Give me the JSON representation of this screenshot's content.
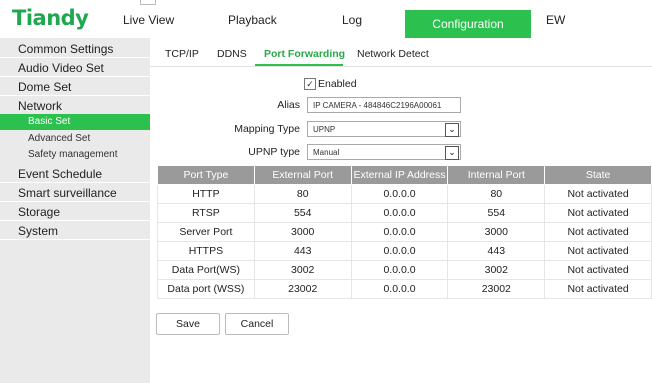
{
  "header": {
    "logo": "Tiandy",
    "nav": [
      {
        "label": "Live View"
      },
      {
        "label": "Playback"
      },
      {
        "label": "Log"
      },
      {
        "label": "Configuration",
        "active": true
      },
      {
        "label": "EW"
      }
    ]
  },
  "sidebar": {
    "items": [
      {
        "label": "Common Settings"
      },
      {
        "label": "Audio Video Set"
      },
      {
        "label": "Dome Set"
      },
      {
        "label": "Network"
      },
      {
        "label": "Basic Set",
        "active": true
      },
      {
        "label": "Advanced Set"
      },
      {
        "label": "Safety management"
      },
      {
        "label": "Event Schedule"
      },
      {
        "label": "Smart surveillance"
      },
      {
        "label": "Storage"
      },
      {
        "label": "System"
      }
    ]
  },
  "tabs": [
    {
      "label": "TCP/IP"
    },
    {
      "label": "DDNS"
    },
    {
      "label": "Port Forwarding",
      "active": true
    },
    {
      "label": "Network Detect"
    }
  ],
  "form": {
    "enabled_label": "Enabled",
    "enabled": true,
    "alias_label": "Alias",
    "alias_value": "IP CAMERA - 484846C2196A00061",
    "mapping_label": "Mapping Type",
    "mapping_value": "UPNP",
    "upnp_label": "UPNP type",
    "upnp_value": "Manual"
  },
  "table": {
    "headers": [
      "Port Type",
      "External Port",
      "External IP Address",
      "Internal Port",
      "State"
    ],
    "rows": [
      [
        "HTTP",
        "80",
        "0.0.0.0",
        "80",
        "Not activated"
      ],
      [
        "RTSP",
        "554",
        "0.0.0.0",
        "554",
        "Not activated"
      ],
      [
        "Server Port",
        "3000",
        "0.0.0.0",
        "3000",
        "Not activated"
      ],
      [
        "HTTPS",
        "443",
        "0.0.0.0",
        "443",
        "Not activated"
      ],
      [
        "Data Port(WS)",
        "3002",
        "0.0.0.0",
        "3002",
        "Not activated"
      ],
      [
        "Data port (WSS)",
        "23002",
        "0.0.0.0",
        "23002",
        "Not activated"
      ]
    ]
  },
  "buttons": {
    "save": "Save",
    "cancel": "Cancel"
  },
  "colors": {
    "accent": "#2cc14f",
    "logo": "#1fa84f",
    "table_header": "#9a9a9a",
    "sidebar_bg": "#eaeaea"
  }
}
